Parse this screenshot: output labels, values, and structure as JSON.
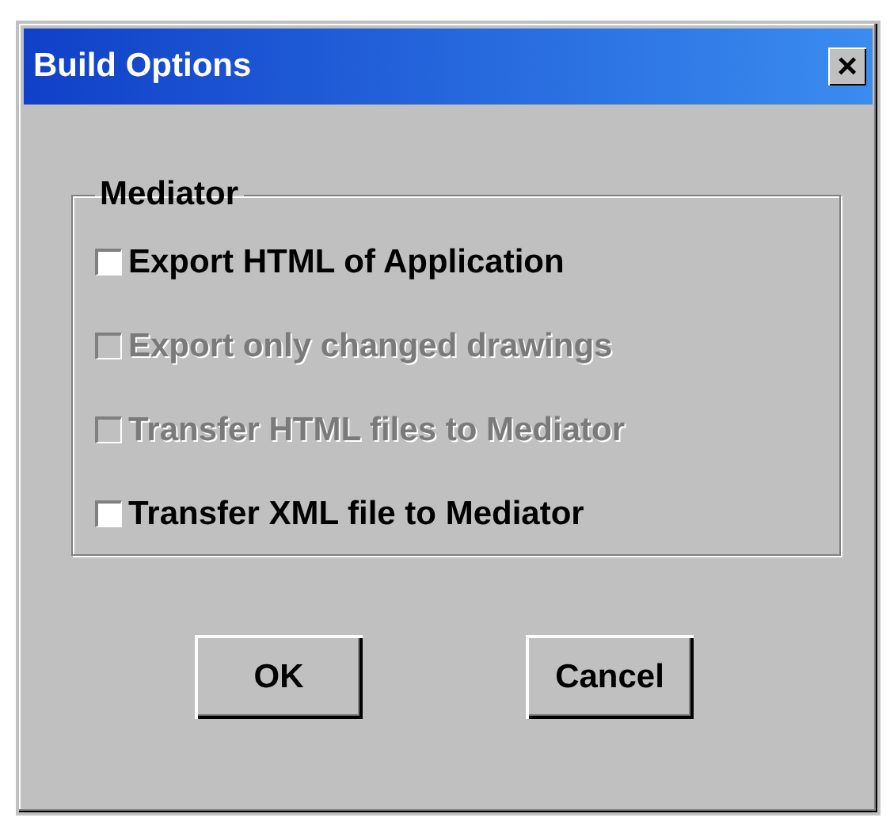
{
  "window": {
    "title": "Build Options",
    "close": "×"
  },
  "group": {
    "label": "Mediator",
    "options": [
      {
        "label": "Export HTML of Application",
        "checked": false,
        "disabled": false
      },
      {
        "label": "Export only changed drawings",
        "checked": false,
        "disabled": true
      },
      {
        "label": "Transfer HTML files to Mediator",
        "checked": false,
        "disabled": true
      },
      {
        "label": "Transfer XML file to Mediator",
        "checked": false,
        "disabled": false
      }
    ]
  },
  "buttons": [
    "OK",
    "Cancel"
  ]
}
